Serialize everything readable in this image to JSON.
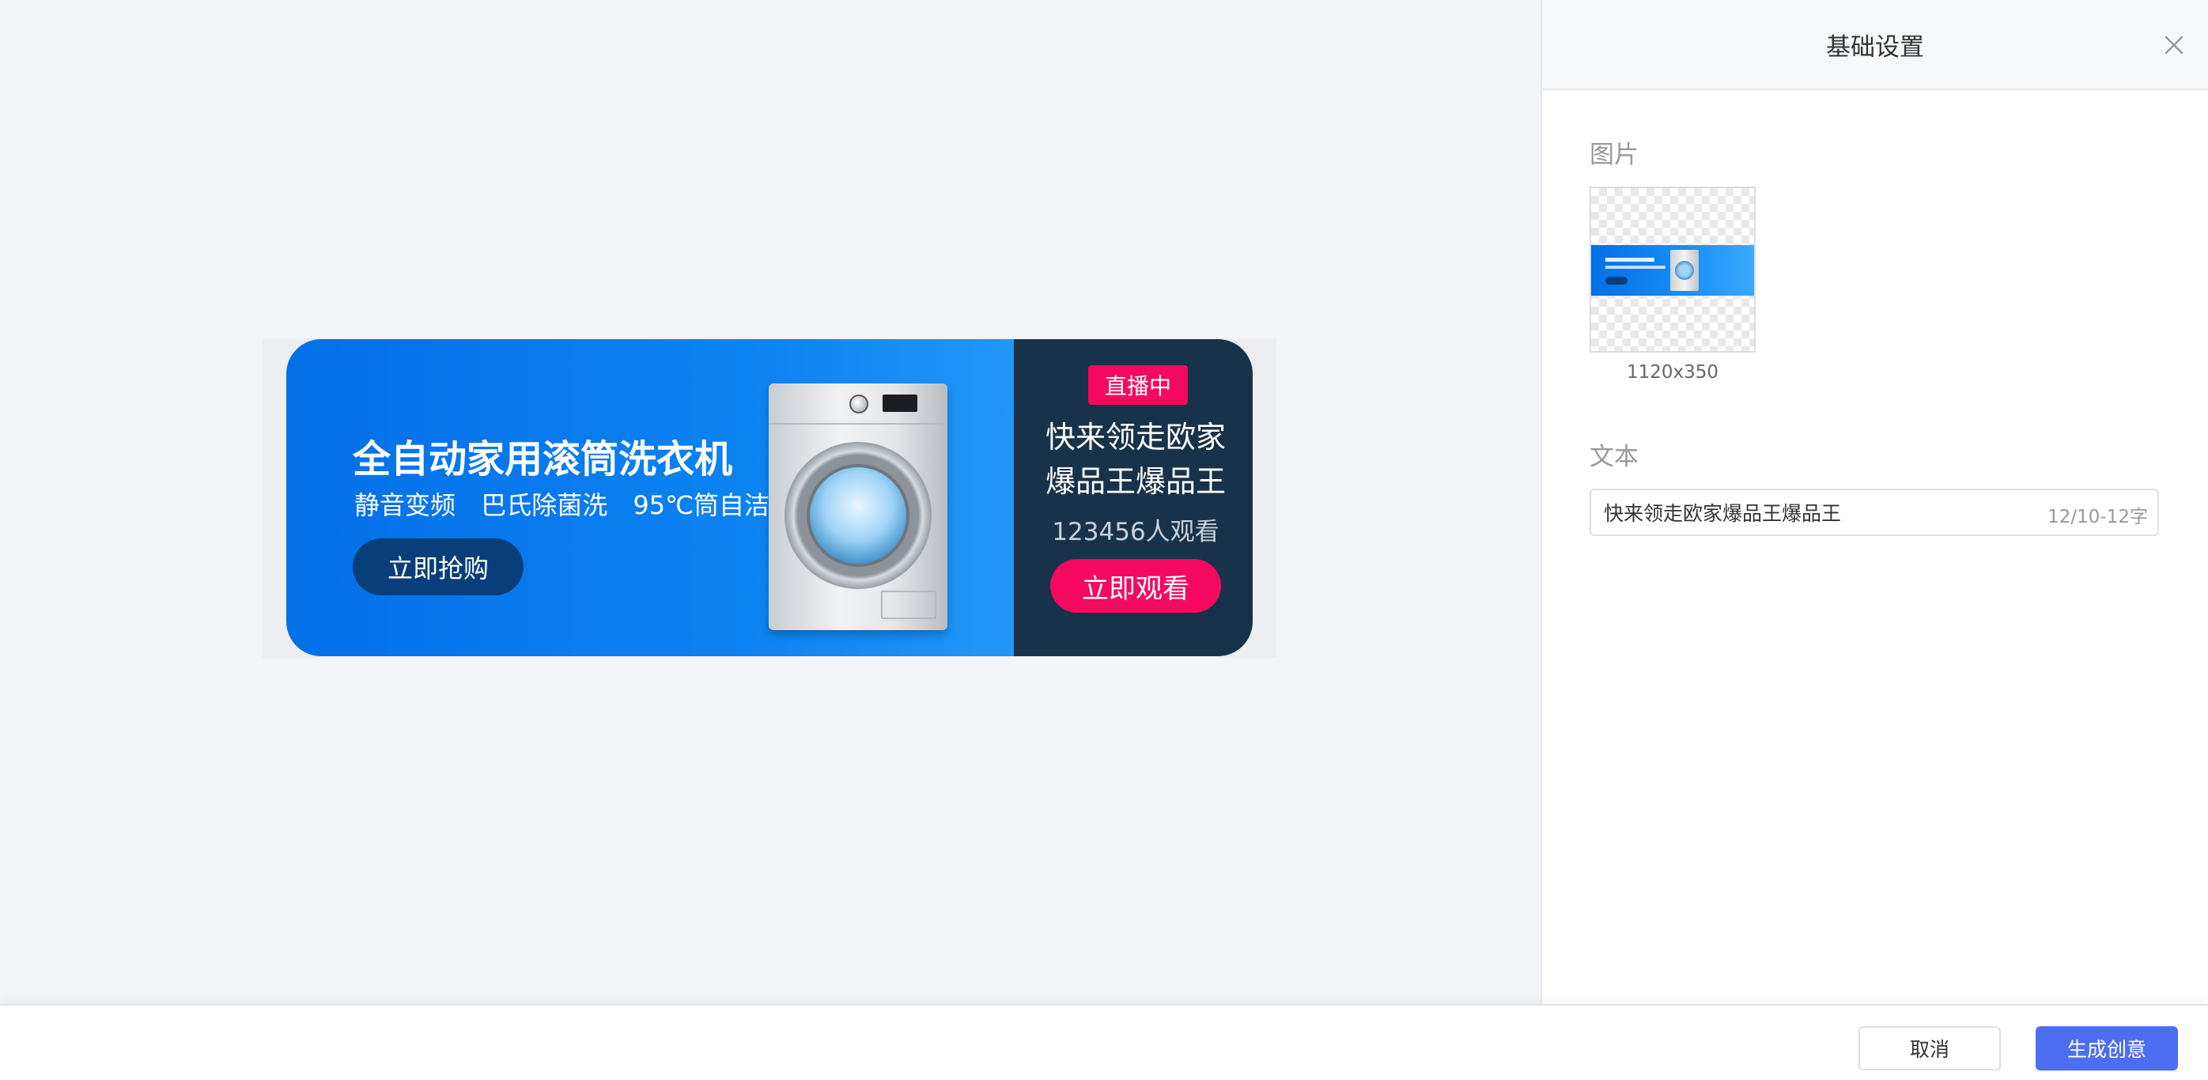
{
  "banner": {
    "headline": "全自动家用滚筒洗衣机",
    "features": [
      "静音变频",
      "巴氏除菌洗",
      "95℃筒自洁"
    ],
    "buy_button": "立即抢购",
    "live_badge": "直播中",
    "live_title": "快来领走欧家爆品王爆品王",
    "viewers": "123456人观看",
    "watch_button": "立即观看",
    "colors": {
      "gradient_start": "#046fe8",
      "gradient_end": "#35a7ff",
      "live_panel": "#183249",
      "accent_pink": "#f5095f",
      "buy_button": "#083f7a"
    }
  },
  "settings": {
    "title": "基础设置",
    "close_icon": "close-icon",
    "image_label": "图片",
    "image_size": "1120x350",
    "text_label": "文本",
    "text_value": "快来领走欧家爆品王爆品王",
    "char_count": "12/10-12字"
  },
  "footer": {
    "cancel_label": "取消",
    "generate_label": "生成创意",
    "primary_color": "#4e6ef2"
  }
}
